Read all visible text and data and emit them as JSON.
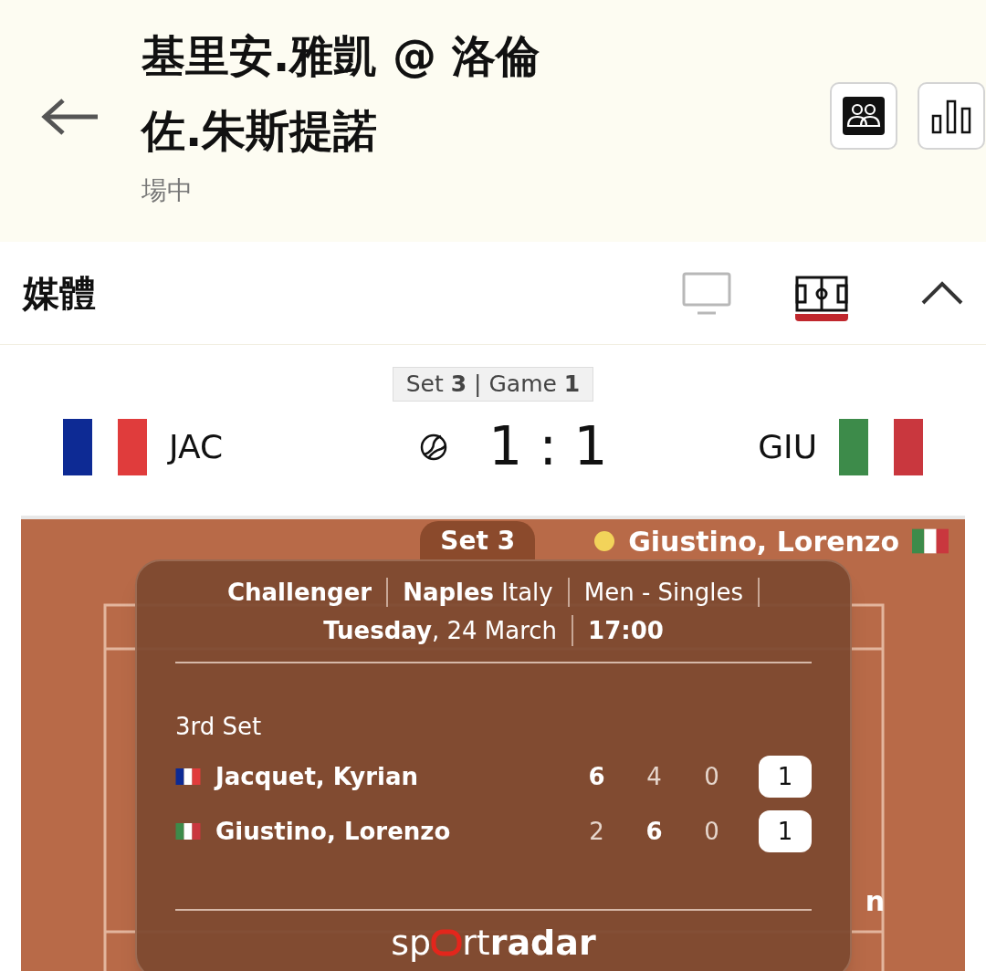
{
  "header": {
    "title": "基里安.雅凱 @ 洛倫佐.朱斯提諾",
    "status": "場中"
  },
  "media": {
    "label": "媒體",
    "tabs": [
      {
        "kind": "tv",
        "selected": false
      },
      {
        "kind": "court",
        "selected": true
      }
    ],
    "expanded": true
  },
  "scoreboard": {
    "period": "Set **3** | Game **1**",
    "home": {
      "code": "JAC",
      "kind": "france"
    },
    "away": {
      "code": "GIU",
      "kind": "italy"
    },
    "score": "1 : 1"
  },
  "court": {
    "set_label": "Set 3",
    "server": {
      "name": "Giustino, Lorenzo",
      "kind": "italy"
    },
    "edge_text": "n",
    "card": {
      "line1": [
        "**Challenger**",
        "**Naples** Italy",
        "Men - Singles"
      ],
      "line2": [
        "**Tuesday**, 24 March",
        "17:00"
      ],
      "set_title": "3rd Set",
      "players": [
        {
          "name": "Jacquet, Kyrian",
          "kind": "france",
          "sets": [
            {
              "value": "6",
              "won": true
            },
            {
              "value": "4",
              "won": false
            },
            {
              "value": "0",
              "won": false
            }
          ],
          "total": "1"
        },
        {
          "name": "Giustino, Lorenzo",
          "kind": "italy",
          "sets": [
            {
              "value": "2",
              "won": false
            },
            {
              "value": "6",
              "won": true
            },
            {
              "value": "0",
              "won": false
            }
          ],
          "total": "1"
        }
      ],
      "logo": {
        "before": "sp",
        "after": "rt",
        "bold": "radar"
      }
    }
  }
}
